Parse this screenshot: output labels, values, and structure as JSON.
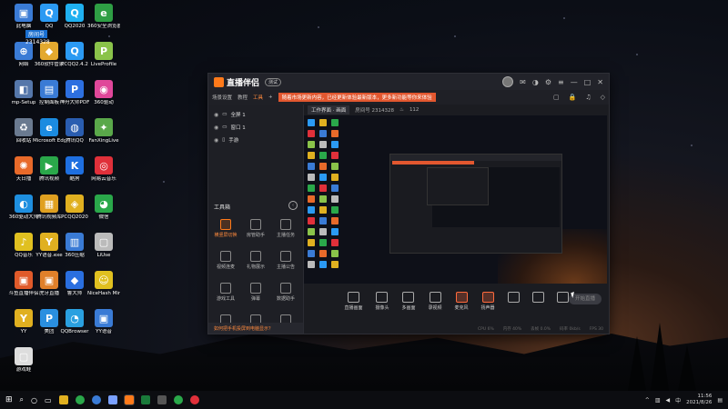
{
  "desktop_icons": [
    {
      "label": "此电脑",
      "color": "#3a7bd5",
      "glyph": "▣"
    },
    {
      "label": "QQ",
      "color": "#2b9af3",
      "glyph": "Q"
    },
    {
      "label": "QQ2020",
      "color": "#1fb0f0",
      "glyph": "Q"
    },
    {
      "label": "360安全浏览器",
      "color": "#2e9e44",
      "glyph": "e"
    },
    {
      "label": "网络",
      "color": "#3a7bd5",
      "glyph": "⊕"
    },
    {
      "label": "360软件管家",
      "color": "#e3a92f",
      "glyph": "◆"
    },
    {
      "label": "PCQQ2.4.2",
      "color": "#2b9af3",
      "glyph": "Q"
    },
    {
      "label": "LiveProfile",
      "color": "#8ac34a",
      "glyph": "P"
    },
    {
      "label": "mp-Setup",
      "color": "#5577aa",
      "glyph": "◧"
    },
    {
      "label": "控制面板",
      "color": "#3a7bd5",
      "glyph": "▤"
    },
    {
      "label": "神舟大师PDF",
      "color": "#2d6fe0",
      "glyph": "P"
    },
    {
      "label": "360驱动",
      "color": "#e0479a",
      "glyph": "◉"
    },
    {
      "label": "回收站",
      "color": "#6a7a90",
      "glyph": "♻"
    },
    {
      "label": "Microsoft Edge",
      "color": "#1b8be0",
      "glyph": "e"
    },
    {
      "label": "腾讯QQ",
      "color": "#2a5db0",
      "glyph": "◍"
    },
    {
      "label": "FanXingLive",
      "color": "#5aa84a",
      "glyph": "✦"
    },
    {
      "label": "天日播",
      "color": "#e86a2a",
      "glyph": "✺"
    },
    {
      "label": "腾讯视频",
      "color": "#2aa84a",
      "glyph": "▶"
    },
    {
      "label": "酷狗",
      "color": "#1e6fe0",
      "glyph": "K"
    },
    {
      "label": "网易云音乐",
      "color": "#e0303a",
      "glyph": "◎"
    },
    {
      "label": "360驱动大师",
      "color": "#1e8fe0",
      "glyph": "◐"
    },
    {
      "label": "腾讯视频库",
      "color": "#e0a020",
      "glyph": "▦"
    },
    {
      "label": "PCQQ2020",
      "color": "#e0b020",
      "glyph": "◈"
    },
    {
      "label": "微信",
      "color": "#2aa84a",
      "glyph": "◕"
    },
    {
      "label": "QQ音乐",
      "color": "#e0c020",
      "glyph": "♪"
    },
    {
      "label": "YY语音.exe",
      "color": "#e0b020",
      "glyph": "Y"
    },
    {
      "label": "360压缩",
      "color": "#3a7bd5",
      "glyph": "▥"
    },
    {
      "label": "LiUse",
      "color": "#bbbbbb",
      "glyph": "▢"
    },
    {
      "label": "斗鱼直播伴侣",
      "color": "#e05a2a",
      "glyph": "▣"
    },
    {
      "label": "虎牙直播",
      "color": "#e0802a",
      "glyph": "▣"
    },
    {
      "label": "鲁大师",
      "color": "#2a6fe0",
      "glyph": "◆"
    },
    {
      "label": "NiceHash Miner",
      "color": "#e0c020",
      "glyph": "☺"
    },
    {
      "label": "YY",
      "color": "#e0b020",
      "glyph": "Y"
    },
    {
      "label": "美团",
      "color": "#2a8fe0",
      "glyph": "P"
    },
    {
      "label": "QQBrowser",
      "color": "#2aa0e0",
      "glyph": "◔"
    },
    {
      "label": "YY语音",
      "color": "#3a7bd5",
      "glyph": "▣"
    },
    {
      "label": "游戏蛙",
      "color": "#dddddd",
      "glyph": "▢"
    }
  ],
  "window": {
    "brand": "直播伴侣",
    "badge": "测试",
    "menu": [
      "场景设置",
      "教程",
      "工具"
    ],
    "banner": "随着市场更新内容，已经更新体验最新版本，更多新功能等你来体验",
    "tabs": [
      "画面设置",
      "进来等待 下载"
    ],
    "scenes": [
      {
        "name": "全屏 1"
      },
      {
        "name": "窗口 1"
      },
      {
        "name": "手游"
      }
    ],
    "toolbox_label": "工具箱",
    "tools": [
      {
        "label": "横竖屏切换",
        "hot": true
      },
      {
        "label": "房管助手",
        "hot": false
      },
      {
        "label": "主播任务",
        "hot": false
      },
      {
        "label": "视频连麦",
        "hot": false
      },
      {
        "label": "礼物展示",
        "hot": false
      },
      {
        "label": "主播公告",
        "hot": false
      },
      {
        "label": "游戏工具",
        "hot": false
      },
      {
        "label": "弹幕",
        "hot": false
      },
      {
        "label": "数据助手",
        "hot": false
      },
      {
        "label": "更多",
        "hot": false
      },
      {
        "label": "",
        "hot": false
      },
      {
        "label": "",
        "hot": false
      }
    ],
    "notice": "如何把手机投屏到电脑显示？",
    "preview_tab": "工作界面 · 画面",
    "room_info": "房间号 2314328",
    "viewer_count": "112",
    "controls": [
      {
        "label": "直播画面",
        "red": false
      },
      {
        "label": "摄像头",
        "red": false
      },
      {
        "label": "多画面",
        "red": false
      },
      {
        "label": "录视频",
        "red": false
      },
      {
        "label": "麦克风",
        "red": true
      },
      {
        "label": "扬声器",
        "red": true
      },
      {
        "label": "",
        "red": false
      },
      {
        "label": "",
        "red": false
      },
      {
        "label": "",
        "red": false
      }
    ],
    "start_label": "开始直播",
    "status": [
      "CPU 6%",
      "内存 40%",
      "丢帧 0.0%",
      "码率 0kb/s",
      "FPS 30"
    ]
  },
  "desktop_labels": {
    "room_label": "房间号",
    "room_number": "2314328"
  },
  "taskbar": {
    "time": "11:56",
    "date": "2021/8/26"
  }
}
